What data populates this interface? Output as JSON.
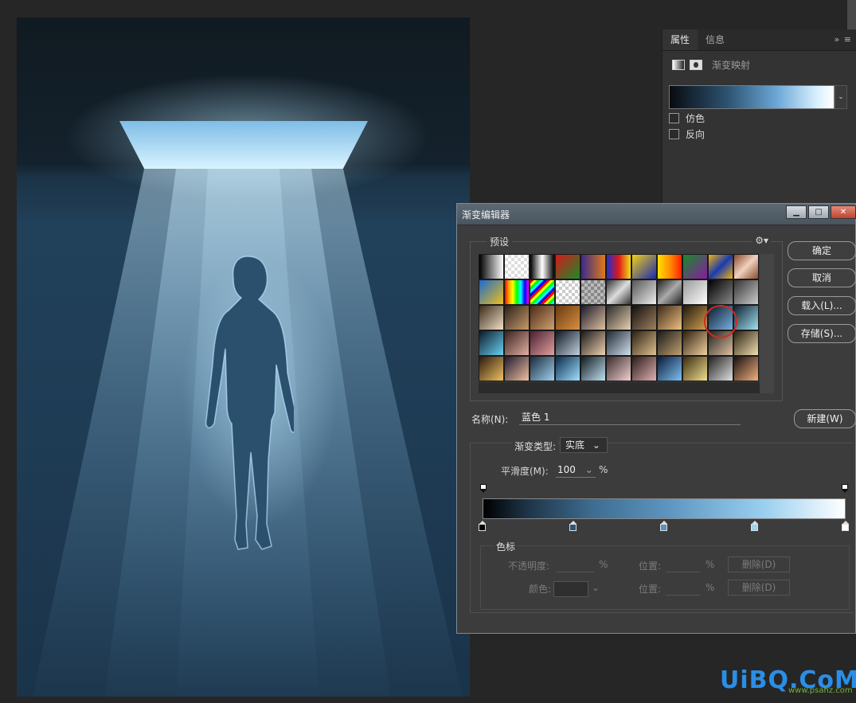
{
  "properties_panel": {
    "tabs": [
      {
        "label": "属性",
        "active": true
      },
      {
        "label": "信息",
        "active": false
      }
    ],
    "menu_glyph": "»  ≡",
    "adjustment_title": "渐变映射",
    "options": [
      {
        "label": "仿色",
        "checked": false
      },
      {
        "label": "反向",
        "checked": false
      }
    ]
  },
  "gradient_editor": {
    "title": "渐变编辑器",
    "window_buttons": {
      "minimize": "▁",
      "maximize": "□",
      "close": "✕"
    },
    "presets_label": "预设",
    "gear_glyph": "⚙▾",
    "buttons": {
      "ok": "确定",
      "cancel": "取消",
      "load": "载入(L)...",
      "save": "存储(S)...",
      "new": "新建(W)"
    },
    "name_label": "名称(N):",
    "name_value": "蓝色 1",
    "type_label": "渐变类型:",
    "type_value": "实底",
    "type_dropdown_glyph": "⌄",
    "smoothness_label": "平滑度(M):",
    "smoothness_value": "100",
    "smoothness_unit": "%",
    "selected_preset_index": 42,
    "color_stops_label": "色标",
    "color_stops": {
      "opacity_label": "不透明度:",
      "opacity_unit": "%",
      "location_label": "位置:",
      "location_unit": "%",
      "delete_label": "删除(D)",
      "color_label": "颜色:"
    },
    "gradient_stops": [
      {
        "location": 0,
        "color": "#000000"
      },
      {
        "location": 25,
        "color": "#2e5676"
      },
      {
        "location": 50,
        "color": "#5a92bf"
      },
      {
        "location": 75,
        "color": "#9fd3f2"
      },
      {
        "location": 100,
        "color": "#ffffff"
      }
    ]
  },
  "presets": [
    "linear-gradient(90deg,#000,#fff)",
    "repeating-conic-gradient(#ddd 0 25%,#fff 0 50%) 0 0/8px 8px",
    "linear-gradient(90deg,#000,#fff,#000)",
    "linear-gradient(135deg,#d41a1a,#1a8a2a)",
    "linear-gradient(90deg,#3a2a8a,#e07a18)",
    "linear-gradient(90deg,#1b2fd0,#e01818,#f0e018)",
    "linear-gradient(135deg,#f0d018,#1a2ab0)",
    "linear-gradient(90deg,#ffe000,#ff9000,#ff2000)",
    "linear-gradient(135deg,#1a8a2a,#8a1aa0)",
    "linear-gradient(135deg,#f0b010,#1a3ab0,#f0b010)",
    "linear-gradient(135deg,#8a4a2a,#f0d0c0,#8a4a2a)",
    "linear-gradient(135deg,#1a6ad0,#f0c018)",
    "linear-gradient(90deg,red,orange,yellow,lime,cyan,blue,magenta)",
    "repeating-linear-gradient(135deg,red 0 3px,yellow 3px 6px,lime 6px 9px,cyan 9px 12px,blue 12px 15px)",
    "repeating-conic-gradient(#ccc 0 25%,#fff 0 50%) 0 0/8px 8px",
    "repeating-conic-gradient(#888 0 25%,#bbb 0 50%) 0 0/8px 8px",
    "linear-gradient(135deg,#333,#ddd,#333)",
    "linear-gradient(135deg,#555,#eee)",
    "linear-gradient(135deg,#222,#aaa,#222)",
    "linear-gradient(135deg,#999,#fff)",
    "linear-gradient(135deg,#000,#888)",
    "linear-gradient(135deg,#333,#ccc)",
    "linear-gradient(135deg,#3a2a18,#f0e0c8)",
    "linear-gradient(135deg,#2a2218,#c89a6a)",
    "linear-gradient(135deg,#4a2a18,#d0a070)",
    "linear-gradient(135deg,#6a3a10,#d89040)",
    "linear-gradient(135deg,#1a1a2a,#e0c0a0)",
    "linear-gradient(135deg,#2a2a2a,#e8d0b0)",
    "linear-gradient(135deg,#101010,#a08060)",
    "linear-gradient(135deg,#3a2a1a,#f0c080)",
    "linear-gradient(135deg,#201810,#d0a050)",
    "linear-gradient(135deg,#0a1a2a,#7ab0e0)",
    "linear-gradient(135deg,#102030,#a0e0f0)",
    "linear-gradient(135deg,#0a1a2a,#6ad0f0)",
    "linear-gradient(135deg,#3a2020,#e0b0a0)",
    "linear-gradient(135deg,#4a2030,#e0a0a0)",
    "linear-gradient(135deg,#101820,#c0d0e0)",
    "linear-gradient(135deg,#181818,#f0d0b0)",
    "linear-gradient(135deg,#202830,#d0e0f0)",
    "linear-gradient(135deg,#2a2010,#e0c090)",
    "linear-gradient(135deg,#1a1a1a,#c0a070)",
    "linear-gradient(135deg,#302010,#f0d0a0)",
    "linear-gradient(135deg,#202020,#e0c0a0)",
    "linear-gradient(135deg,#2a2010,#f0e0b0)",
    "linear-gradient(135deg,#2a1a10,#f0c060)",
    "linear-gradient(135deg,#201a30,#f0c0a0)",
    "linear-gradient(135deg,#1a2a3a,#a0d0f0)",
    "linear-gradient(135deg,#0a2a4a,#a0e0ff)",
    "linear-gradient(135deg,#101a20,#c0e0f0)",
    "linear-gradient(135deg,#3a2a2a,#f0d0d0)",
    "linear-gradient(135deg,#2a1a1a,#e0b0b0)",
    "linear-gradient(135deg,#0a1a3a,#80c0f0)",
    "linear-gradient(135deg,#3a2a10,#f0e090)",
    "linear-gradient(135deg,#202020,#e0e0e0)",
    "linear-gradient(135deg,#1a1010,#f0b080)"
  ],
  "watermark": {
    "main": "UiBQ.CoM",
    "sub": "www.psahz.com"
  },
  "colors": {
    "accent_blue": "#2a8ee6",
    "annotation_red": "#cf2c22",
    "dialog_bg": "#3c3c3c"
  }
}
